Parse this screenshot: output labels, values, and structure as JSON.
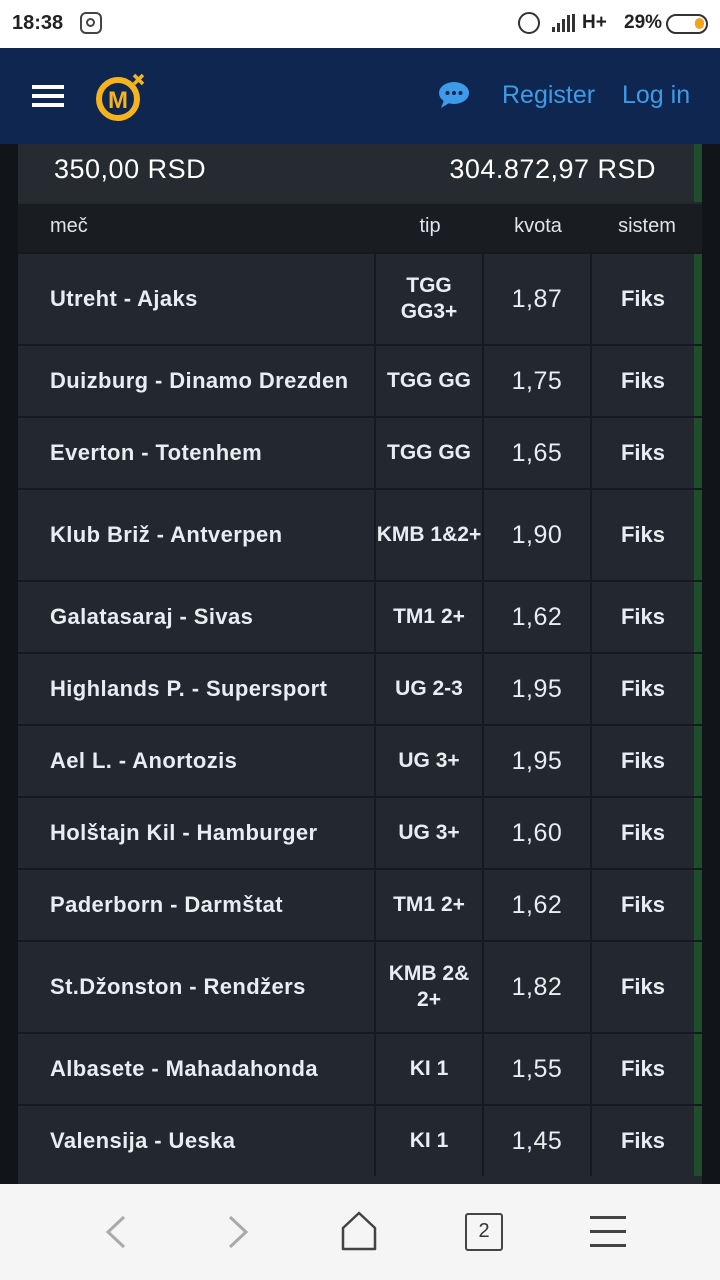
{
  "status_bar": {
    "time": "18:38",
    "network": "H+",
    "battery": "29%"
  },
  "header": {
    "register_label": "Register",
    "login_label": "Log in",
    "accent_color": "#3d9be9",
    "background_color": "#0f2650"
  },
  "summary": {
    "stake": "350,00 RSD",
    "win": "304.872,97 RSD"
  },
  "table": {
    "columns": [
      "meč",
      "tip",
      "kvota",
      "sistem"
    ],
    "rows": [
      {
        "match": "Utreht - Ajaks",
        "tip": "TGG GG3+",
        "odd": "1,87",
        "system": "Fiks"
      },
      {
        "match": "Duizburg - Dinamo Drezden",
        "tip": "TGG GG",
        "odd": "1,75",
        "system": "Fiks"
      },
      {
        "match": "Everton - Totenhem",
        "tip": "TGG GG",
        "odd": "1,65",
        "system": "Fiks"
      },
      {
        "match": "Klub Briž - Antverpen",
        "tip": "KMB 1&2+",
        "odd": "1,90",
        "system": "Fiks"
      },
      {
        "match": "Galatasaraj - Sivas",
        "tip": "TM1 2+",
        "odd": "1,62",
        "system": "Fiks"
      },
      {
        "match": "Highlands P. - Supersport",
        "tip": "UG 2-3",
        "odd": "1,95",
        "system": "Fiks"
      },
      {
        "match": "Ael L. - Anortozis",
        "tip": "UG 3+",
        "odd": "1,95",
        "system": "Fiks"
      },
      {
        "match": "Holštajn Kil - Hamburger",
        "tip": "UG 3+",
        "odd": "1,60",
        "system": "Fiks"
      },
      {
        "match": "Paderborn - Darmštat",
        "tip": "TM1 2+",
        "odd": "1,62",
        "system": "Fiks"
      },
      {
        "match": "St.Džonston - Rendžers",
        "tip": "KMB 2& 2+",
        "odd": "1,82",
        "system": "Fiks"
      },
      {
        "match": "Albasete - Mahadahonda",
        "tip": "KI 1",
        "odd": "1,55",
        "system": "Fiks"
      },
      {
        "match": "Valensija - Ueska",
        "tip": "KI 1",
        "odd": "1,45",
        "system": "Fiks"
      }
    ]
  },
  "browser_bar": {
    "tab_count": "2"
  },
  "icons": [
    "instagram-icon",
    "alarm-icon",
    "signal-icon",
    "battery-icon",
    "hamburger-menu-icon",
    "mozzart-logo",
    "chat-icon",
    "back-arrow-icon",
    "forward-arrow-icon",
    "home-icon",
    "tabs-icon",
    "browser-menu-icon"
  ]
}
